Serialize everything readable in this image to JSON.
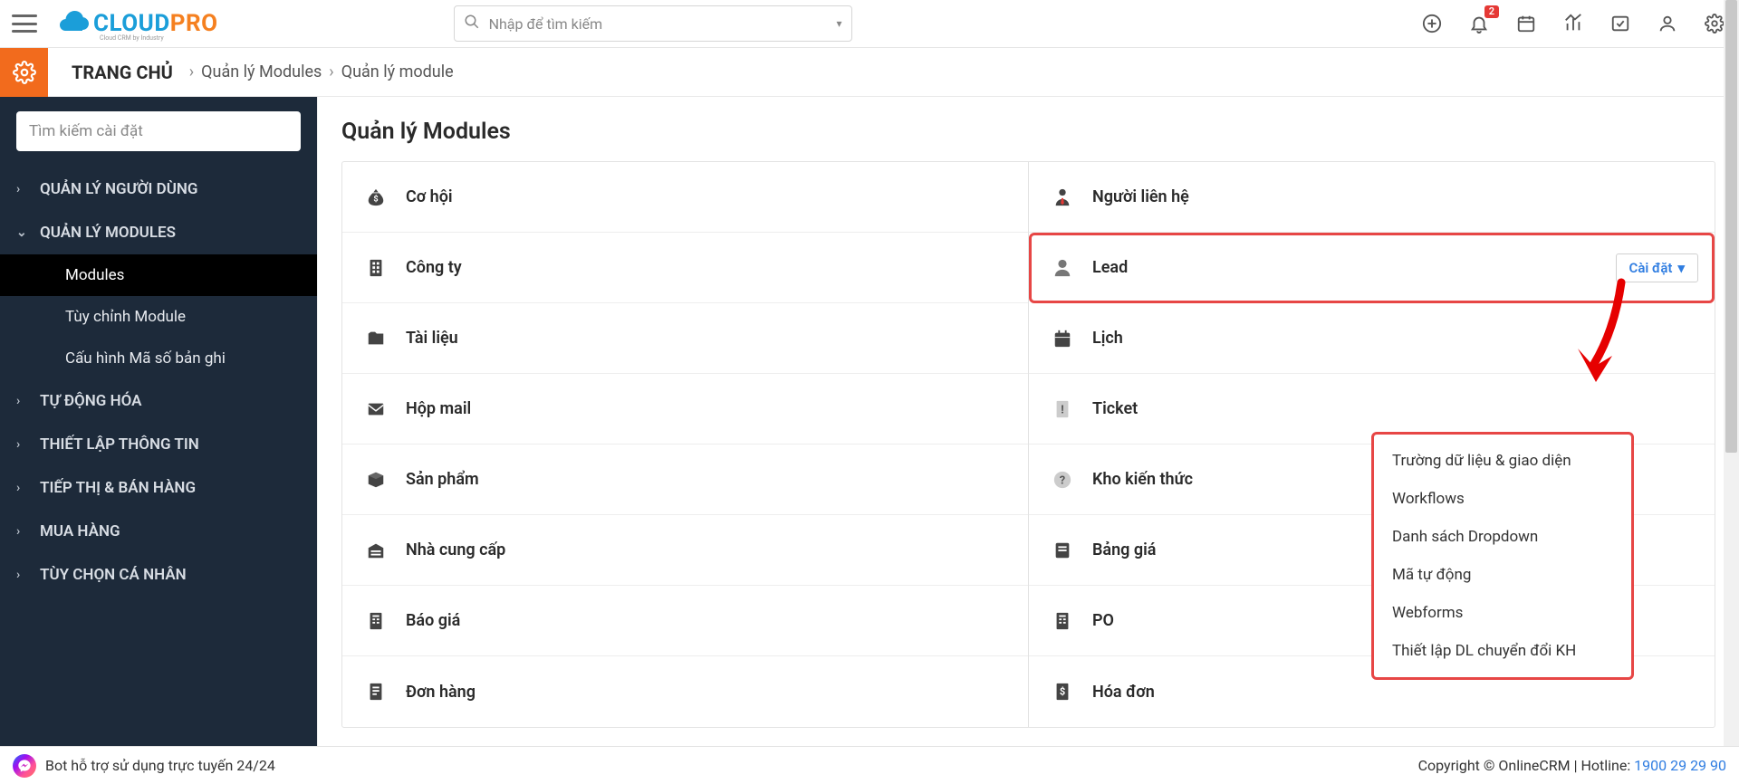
{
  "header": {
    "search_placeholder": "Nhập để tìm kiếm",
    "notif_badge": "2"
  },
  "logo": {
    "cloud": "CLOUD",
    "pro": "PRO",
    "sub": "Cloud CRM by Industry"
  },
  "breadcrumb": {
    "home": "TRANG CHỦ",
    "item1": "Quản lý Modules",
    "item2": "Quản lý module"
  },
  "sidebar": {
    "search_placeholder": "Tìm kiếm cài đặt",
    "groups": [
      {
        "label": "QUẢN LÝ NGƯỜI DÙNG",
        "expanded": false,
        "children": []
      },
      {
        "label": "QUẢN LÝ MODULES",
        "expanded": true,
        "children": [
          {
            "label": "Modules",
            "active": true
          },
          {
            "label": "Tùy chỉnh Module",
            "active": false
          },
          {
            "label": "Cấu hình Mã số bản ghi",
            "active": false
          }
        ]
      },
      {
        "label": "TỰ ĐỘNG HÓA",
        "expanded": false,
        "children": []
      },
      {
        "label": "THIẾT LẬP THÔNG TIN",
        "expanded": false,
        "children": []
      },
      {
        "label": "TIẾP THỊ & BÁN HÀNG",
        "expanded": false,
        "children": []
      },
      {
        "label": "MUA HÀNG",
        "expanded": false,
        "children": []
      },
      {
        "label": "TÙY CHỌN CÁ NHÂN",
        "expanded": false,
        "children": []
      }
    ]
  },
  "page": {
    "title": "Quản lý Modules",
    "settings_label": "Cài đặt",
    "left_col": [
      {
        "icon": "money-bag",
        "label": "Cơ hội"
      },
      {
        "icon": "building",
        "label": "Công ty"
      },
      {
        "icon": "folder",
        "label": "Tài liệu"
      },
      {
        "icon": "mail",
        "label": "Hộp mail"
      },
      {
        "icon": "box",
        "label": "Sản phẩm"
      },
      {
        "icon": "warehouse",
        "label": "Nhà cung cấp"
      },
      {
        "icon": "doc-calc",
        "label": "Báo giá"
      },
      {
        "icon": "doc-lines",
        "label": "Đơn hàng"
      }
    ],
    "right_col": [
      {
        "icon": "person-tie",
        "label": "Người liên hệ"
      },
      {
        "icon": "person",
        "label": "Lead",
        "highlight": true,
        "show_settings": true
      },
      {
        "icon": "calendar",
        "label": "Lịch"
      },
      {
        "icon": "alert-doc",
        "label": "Ticket"
      },
      {
        "icon": "question",
        "label": "Kho kiến thức"
      },
      {
        "icon": "book",
        "label": "Bảng giá"
      },
      {
        "icon": "doc-calc",
        "label": "PO"
      },
      {
        "icon": "doc-dollar",
        "label": "Hóa đơn"
      }
    ]
  },
  "dropdown": {
    "items": [
      "Trường dữ liệu & giao diện",
      "Workflows",
      "Danh sách Dropdown",
      "Mã tự động",
      "Webforms",
      "Thiết lập DL chuyển đổi KH"
    ]
  },
  "footer": {
    "bot": "Bot hỗ trợ sử dụng trực tuyến 24/24",
    "copyright": "Copyright © OnlineCRM ",
    "hotline_label": "| Hotline: ",
    "hotline": "1900 29 29 90"
  }
}
